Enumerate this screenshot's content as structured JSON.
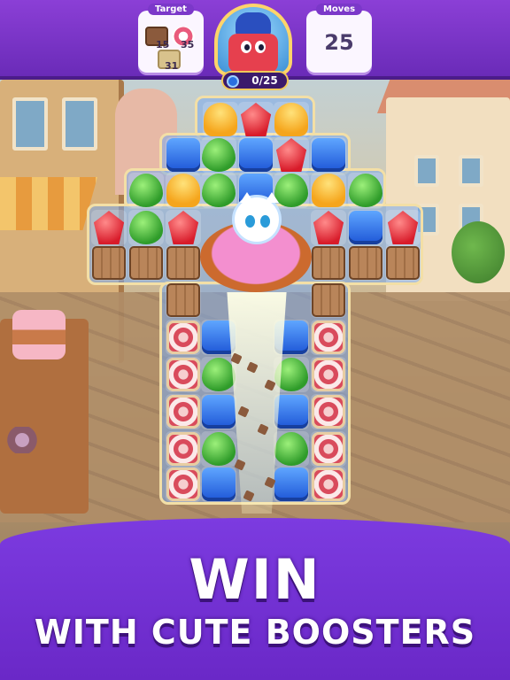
{
  "hud": {
    "target_label": "Target",
    "target_items": [
      {
        "icon": "chocolate-icon",
        "count": "15"
      },
      {
        "icon": "lollipop-icon",
        "count": "35"
      },
      {
        "icon": "cookie-crate-icon",
        "count": "31"
      }
    ],
    "moves_label": "Moves",
    "moves_value": "25",
    "progress_text": "0/25"
  },
  "banner": {
    "line1": "WIN",
    "line2": "WITH CUTE BOOSTERS"
  },
  "colors": {
    "primary_purple": "#7c3be0",
    "gold_border": "#f3dfa6",
    "red_gem": "#d81b2a",
    "blue_gem": "#1d55d6",
    "green_gem": "#2f9c2a",
    "yellow_gem": "#f5a51c"
  }
}
